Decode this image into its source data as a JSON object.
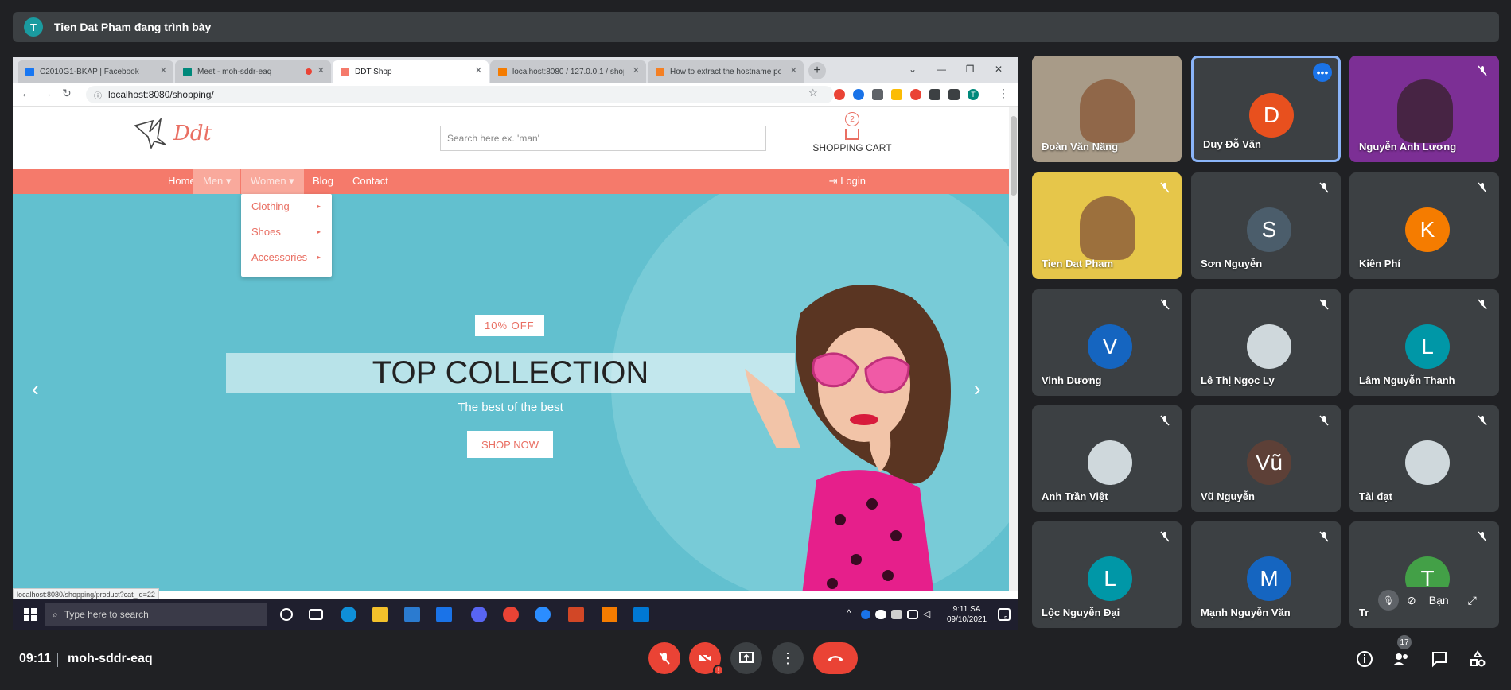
{
  "presenter": {
    "avatar_letter": "T",
    "text": "Tien Dat Pham đang trình bày"
  },
  "browser": {
    "tabs": [
      {
        "label": "C2010G1-BKAP | Facebook",
        "color": "#1877f2"
      },
      {
        "label": "Meet - moh-sddr-eaq",
        "color": "#00897b"
      },
      {
        "label": "DDT Shop",
        "color": "#f57a6b"
      },
      {
        "label": "localhost:8080 / 127.0.0.1 / shop",
        "color": "#f57c00"
      },
      {
        "label": "How to extract the hostname po",
        "color": "#f48024"
      }
    ],
    "new_tab": "+",
    "url": "localhost:8080/shopping/",
    "status_url": "localhost:8080/shopping/product?cat_id=22",
    "profile_letter": "T"
  },
  "shop": {
    "logo_text": "Ddt",
    "search_placeholder": "Search here ex. 'man'",
    "cart_count": "2",
    "cart_label": "SHOPPING CART",
    "menu": [
      "Home",
      "Men",
      "Women",
      "Blog",
      "Contact"
    ],
    "login": "Login",
    "dropdown": [
      "Clothing",
      "Shoes",
      "Accessories"
    ],
    "hero": {
      "badge": "10% OFF",
      "title": "TOP COLLECTION",
      "subtitle": "The best of the best",
      "button": "SHOP NOW"
    }
  },
  "taskbar": {
    "search_placeholder": "Type here to search",
    "time": "9:11 SA",
    "date": "09/10/2021",
    "notif_count": "5"
  },
  "participants": [
    {
      "name": "Đoàn Văn Năng",
      "type": "video",
      "muted": false
    },
    {
      "name": "Duy Đỗ Văn",
      "type": "avatar",
      "letter": "D",
      "color": "#e8501e",
      "muted": false,
      "selected": true
    },
    {
      "name": "Nguyễn Anh Lương",
      "type": "video",
      "muted": true
    },
    {
      "name": "Tien Dat Pham",
      "type": "video",
      "muted": true
    },
    {
      "name": "Sơn Nguyễn",
      "type": "avatar",
      "letter": "S",
      "color": "#4b5d6b",
      "muted": true
    },
    {
      "name": "Kiên Phí",
      "type": "avatar",
      "letter": "K",
      "color": "#f57c00",
      "muted": true
    },
    {
      "name": "Vinh Dương",
      "type": "avatar",
      "letter": "V",
      "color": "#1565c0",
      "muted": true
    },
    {
      "name": "Lê Thị Ngọc Ly",
      "type": "photo",
      "muted": true
    },
    {
      "name": "Lâm Nguyễn Thanh",
      "type": "avatar",
      "letter": "L",
      "color": "#0097a7",
      "muted": true
    },
    {
      "name": "Anh Trần Việt",
      "type": "photo",
      "muted": true
    },
    {
      "name": "Vũ Nguyễn",
      "type": "avatar",
      "letter": "Vũ",
      "color": "#5d4037",
      "muted": true
    },
    {
      "name": "Tài đạt",
      "type": "photo",
      "muted": true
    },
    {
      "name": "Lộc Nguyễn Đại",
      "type": "avatar",
      "letter": "L",
      "color": "#0097a7",
      "muted": true
    },
    {
      "name": "Mạnh Nguyễn Văn",
      "type": "avatar",
      "letter": "M",
      "color": "#1565c0",
      "muted": true
    },
    {
      "name": "Tr",
      "type": "avatar",
      "letter": "T",
      "color": "#43a047",
      "muted": true
    }
  ],
  "self_view": {
    "label": "Bạn"
  },
  "meeting": {
    "time": "09:11",
    "code": "moh-sddr-eaq",
    "participant_count": "17"
  }
}
